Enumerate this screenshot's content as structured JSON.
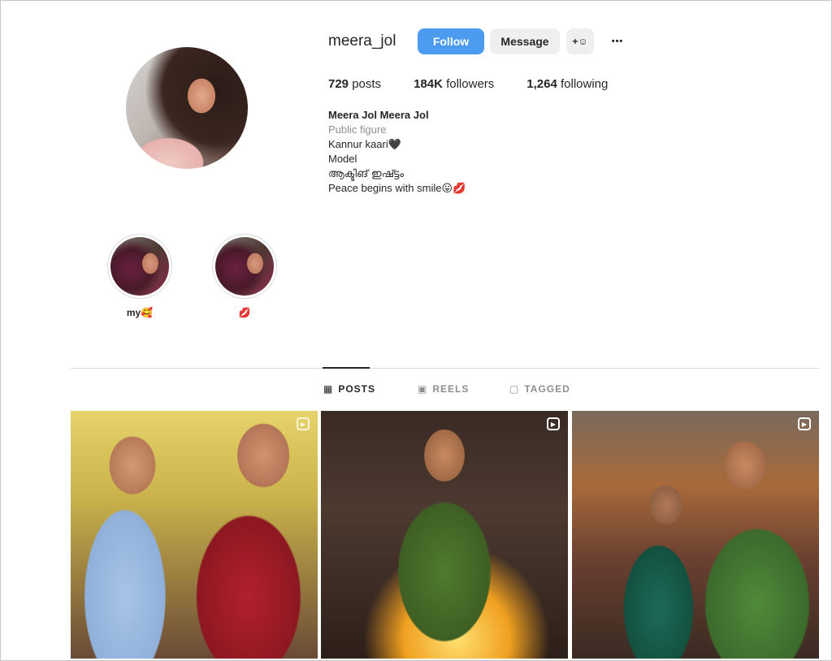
{
  "profile": {
    "username": "meera_jol",
    "follow_label": "Follow",
    "message_label": "Message",
    "add_user_glyph": "+☺",
    "more_glyph": "•••",
    "stats": {
      "posts_count": "729",
      "posts_label": "posts",
      "followers_count": "184K",
      "followers_label": "followers",
      "following_count": "1,264",
      "following_label": "following"
    },
    "bio": {
      "name": "Meera Jol Meera Jol",
      "category": "Public figure",
      "line1": "Kannur kaari🖤",
      "line2": "Model",
      "line3": "ആക്ടിങ് ഇഷ്ട്ടം",
      "line4": "Peace begins with smile😛💋"
    }
  },
  "highlights": [
    {
      "label": "my🥰"
    },
    {
      "label": "💋"
    }
  ],
  "tabs": [
    {
      "label": "POSTS",
      "icon": "grid-icon",
      "glyph": "▦"
    },
    {
      "label": "REELS",
      "icon": "reels-icon",
      "glyph": "▣"
    },
    {
      "label": "TAGGED",
      "icon": "tagged-icon",
      "glyph": "▢"
    }
  ],
  "posts": [
    {
      "type": "reel",
      "icon": "reel-icon"
    },
    {
      "type": "reel",
      "icon": "reel-icon"
    },
    {
      "type": "reel",
      "icon": "reel-icon"
    }
  ]
}
